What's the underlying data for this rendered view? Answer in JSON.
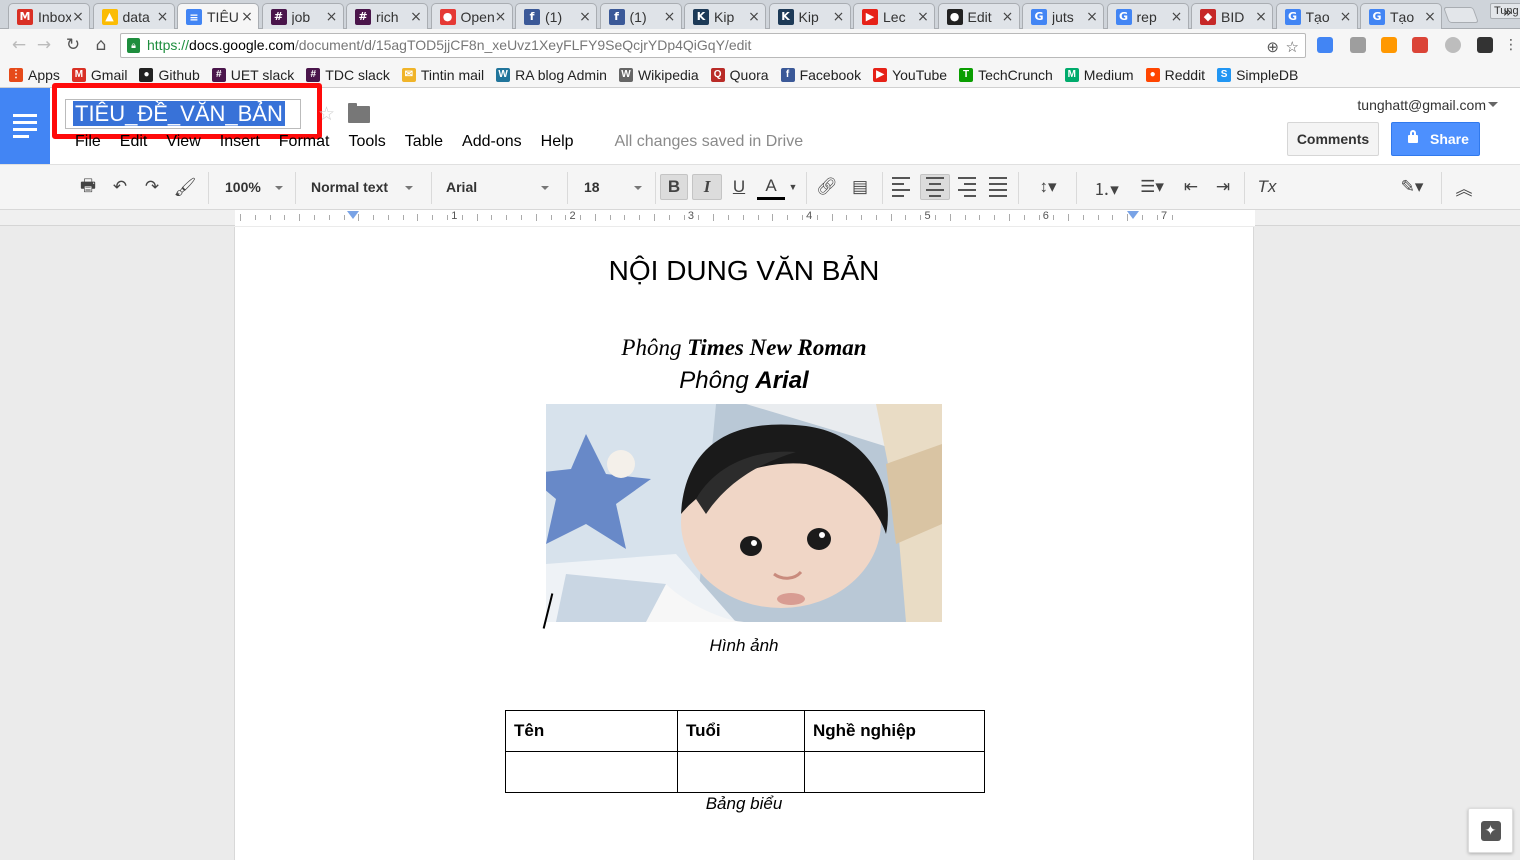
{
  "browser": {
    "tabs": [
      {
        "title": "Inbox",
        "icon": "gmail-icon",
        "color": "#d93025",
        "glyph": "M"
      },
      {
        "title": "data",
        "icon": "drive-icon",
        "color": "#fbbc04",
        "glyph": "▲"
      },
      {
        "title": "TIÊU",
        "icon": "docs-icon",
        "color": "#4285f4",
        "glyph": "≡",
        "active": true
      },
      {
        "title": "job",
        "icon": "slack-icon",
        "color": "#4a154b",
        "glyph": "#"
      },
      {
        "title": "rich",
        "icon": "slack-icon",
        "color": "#4a154b",
        "glyph": "#"
      },
      {
        "title": "Open",
        "icon": "pokeball-icon",
        "color": "#e53935",
        "glyph": "●"
      },
      {
        "title": "(1)",
        "icon": "facebook-icon",
        "color": "#3b5998",
        "glyph": "f"
      },
      {
        "title": "(1)",
        "icon": "facebook-icon",
        "color": "#3b5998",
        "glyph": "f"
      },
      {
        "title": "Kip",
        "icon": "kipalog-icon",
        "color": "#1d3a57",
        "glyph": "K"
      },
      {
        "title": "Kip",
        "icon": "kipalog-icon",
        "color": "#1d3a57",
        "glyph": "K"
      },
      {
        "title": "Lec",
        "icon": "youtube-icon",
        "color": "#e62117",
        "glyph": "▶"
      },
      {
        "title": "Edit",
        "icon": "github-icon",
        "color": "#222222",
        "glyph": "●"
      },
      {
        "title": "juts",
        "icon": "google-icon",
        "color": "#4285f4",
        "glyph": "G"
      },
      {
        "title": "rep",
        "icon": "google-icon",
        "color": "#4285f4",
        "glyph": "G"
      },
      {
        "title": "BID",
        "icon": "bidv-icon",
        "color": "#c62828",
        "glyph": "◆"
      },
      {
        "title": "Tạo",
        "icon": "google-icon",
        "color": "#4285f4",
        "glyph": "G"
      },
      {
        "title": "Tạo",
        "icon": "google-icon",
        "color": "#4285f4",
        "glyph": "G"
      }
    ],
    "profile_name": "Tung",
    "url_scheme": "https://",
    "url_host": "docs.google.com",
    "url_path": "/document/d/15agTOD5jjCF8n_xeUvz1XeyFLFY9SeQcjrYDp4QiGqY/edit"
  },
  "bookmarks": [
    {
      "label": "Apps",
      "icon": "apps-grid-icon",
      "color": "#e64a19",
      "glyph": "⋮"
    },
    {
      "label": "Gmail",
      "icon": "gmail-icon",
      "color": "#d93025",
      "glyph": "M"
    },
    {
      "label": "Github",
      "icon": "github-icon",
      "color": "#222222",
      "glyph": "●"
    },
    {
      "label": "UET slack",
      "icon": "slack-icon",
      "color": "#4a154b",
      "glyph": "#"
    },
    {
      "label": "TDC slack",
      "icon": "slack-icon",
      "color": "#4a154b",
      "glyph": "#"
    },
    {
      "label": "Tintin mail",
      "icon": "mail-icon",
      "color": "#f0b429",
      "glyph": "✉"
    },
    {
      "label": "RA blog Admin",
      "icon": "wordpress-icon",
      "color": "#21759b",
      "glyph": "W"
    },
    {
      "label": "Wikipedia",
      "icon": "wikipedia-icon",
      "color": "#666666",
      "glyph": "W"
    },
    {
      "label": "Quora",
      "icon": "quora-icon",
      "color": "#b92b27",
      "glyph": "Q"
    },
    {
      "label": "Facebook",
      "icon": "facebook-icon",
      "color": "#3b5998",
      "glyph": "f"
    },
    {
      "label": "YouTube",
      "icon": "youtube-icon",
      "color": "#e62117",
      "glyph": "▶"
    },
    {
      "label": "TechCrunch",
      "icon": "techcrunch-icon",
      "color": "#0a9e01",
      "glyph": "T"
    },
    {
      "label": "Medium",
      "icon": "medium-icon",
      "color": "#00ab6c",
      "glyph": "M"
    },
    {
      "label": "Reddit",
      "icon": "reddit-icon",
      "color": "#ff4500",
      "glyph": "●"
    },
    {
      "label": "SimpleDB",
      "icon": "simpledb-icon",
      "color": "#2196f3",
      "glyph": "S"
    }
  ],
  "docs": {
    "title": "TIÊU_ĐỀ_VĂN_BẢN",
    "menus": [
      "File",
      "Edit",
      "View",
      "Insert",
      "Format",
      "Tools",
      "Table",
      "Add-ons",
      "Help"
    ],
    "save_status": "All changes saved in Drive",
    "user_email": "tunghatt@gmail.com",
    "comments_label": "Comments",
    "share_label": "Share",
    "accent_color": "#4285f4",
    "highlight_color": "#ff0a0a"
  },
  "toolbar": {
    "zoom": "100%",
    "style": "Normal text",
    "font": "Arial",
    "font_size": "18",
    "bold_label": "B",
    "italic_label": "I",
    "underline_label": "U",
    "text_color_label": "A",
    "clear_format_label": "Tx"
  },
  "ruler": {
    "numbers": [
      "1",
      "2",
      "3",
      "4",
      "5",
      "6",
      "7"
    ]
  },
  "document": {
    "heading": "NỘI DUNG VĂN BẢN",
    "tnr_prefix": "Phông ",
    "tnr_bold": "Times New Roman",
    "arial_prefix": "Phông ",
    "arial_bold": "Arial",
    "image_caption": "Hình ảnh",
    "table_headers": [
      "Tên",
      "Tuổi",
      "Nghề nghiệp"
    ],
    "table_rows": [
      [
        "",
        "",
        ""
      ]
    ],
    "table_caption": "Bảng biểu"
  }
}
